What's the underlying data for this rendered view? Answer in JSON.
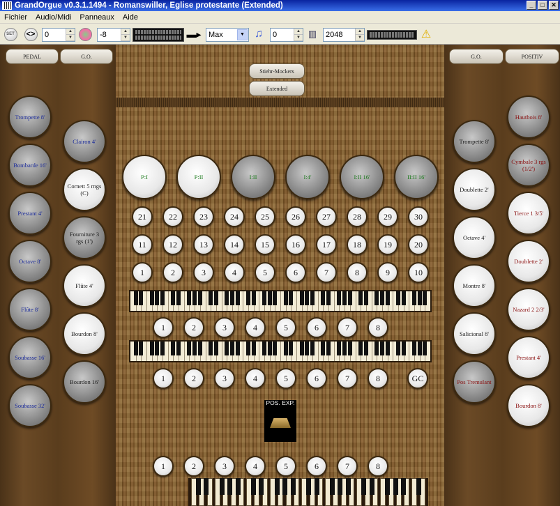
{
  "window": {
    "title": "GrandOrgue v0.3.1.1494 - Romanswiller, Eglise protestante (Extended)"
  },
  "menu": [
    "Fichier",
    "Audio/Midi",
    "Panneaux",
    "Aide"
  ],
  "toolbar": {
    "set_label": "SET",
    "memory": "0",
    "volume": "-8",
    "polyphony": "Max",
    "transpose": "0",
    "release_length": "2048"
  },
  "tabs": {
    "pedal": "PEDAL",
    "go_left": "G.O.",
    "go_right": "G.O.",
    "positiv": "POSITIV",
    "tuning": "Stiehr-Mockers",
    "extended": "Extended"
  },
  "pedal_stops": [
    "Trompette 8'",
    "Bombarde 16'",
    "Prestant 4'",
    "Octave 8'",
    "Flûte 8'",
    "Soubasse 16'",
    "Soubasse 32'"
  ],
  "go_left_stops": [
    "Clairon 4'",
    "Cornett 5 rngs (C)",
    "Fourniture 3 rgs (1')",
    "Flûte 4'",
    "Bourdon 8'",
    "Bourdon 16'"
  ],
  "go_right_stops": [
    "Trompette 8'",
    "Doublette 2'",
    "Octave 4'",
    "Montre 8'",
    "Salicional 8'",
    "Pos Tremulant"
  ],
  "positiv_stops": [
    "Hautbois 8'",
    "Cymbale 3 rgs (1/2')",
    "Tierce 1 3/5'",
    "Doublette 2'",
    "Nazard 2 2/3'",
    "Prestant 4'",
    "Bourdon 8'"
  ],
  "couplers": [
    "P:I",
    "P:II",
    "I:II",
    "I:4'",
    "I:II 16'",
    "II:II 16'"
  ],
  "general_pistons": [
    [
      "21",
      "22",
      "23",
      "24",
      "25",
      "26",
      "27",
      "28",
      "29",
      "30"
    ],
    [
      "11",
      "12",
      "13",
      "14",
      "15",
      "16",
      "17",
      "18",
      "19",
      "20"
    ],
    [
      "1",
      "2",
      "3",
      "4",
      "5",
      "6",
      "7",
      "8",
      "9",
      "10"
    ]
  ],
  "divisional_pistons": [
    "1",
    "2",
    "3",
    "4",
    "5",
    "6",
    "7",
    "8"
  ],
  "gc_label": "GC",
  "expression": {
    "label": "POS. EXP."
  },
  "colors": {
    "titlebar": "#0a24a0",
    "wood": "#6b4a26",
    "stop_on": "#ffffff",
    "stop_off": "#7d7d7d"
  }
}
